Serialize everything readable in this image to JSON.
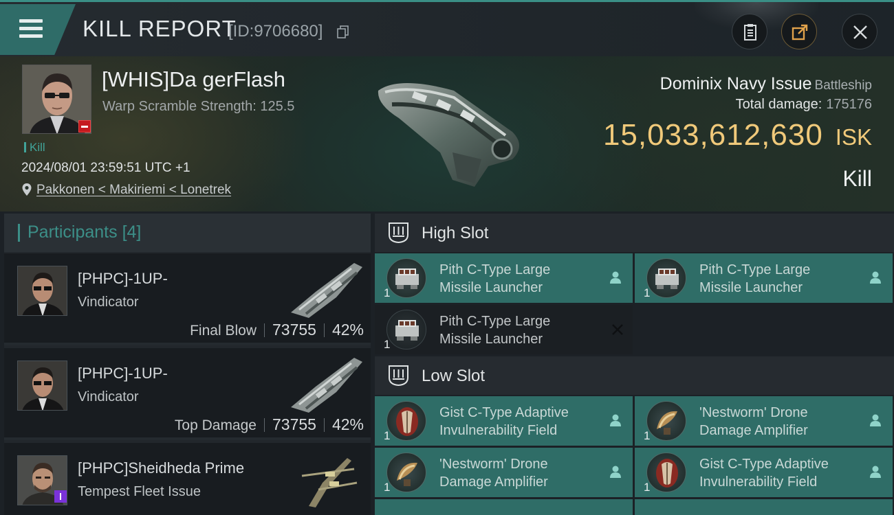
{
  "header": {
    "title": "KILL REPORT",
    "id_text": "[ID:9706680]",
    "icons": [
      "menu-icon",
      "copy-icon",
      "clipboard-icon",
      "share-icon",
      "close-icon"
    ]
  },
  "victim": {
    "name": "[WHIS]Da gerFlash",
    "warp_scramble": "Warp Scramble Strength: 125.5",
    "kill_tag": "Kill",
    "datetime": "2024/08/01 23:59:51 UTC +1",
    "location": "Pakkonen < Makiriemi < Lonetrek",
    "ship_name": "Dominix Navy Issue",
    "ship_class": "Battleship",
    "total_damage_label": "Total damage:",
    "total_damage_value": "175176",
    "isk_value": "15,033,612,630",
    "isk_unit": "ISK",
    "result": "Kill"
  },
  "participants": {
    "header": "Participants",
    "count": "[4]",
    "items": [
      {
        "name": "[PHPC]-1UP-",
        "ship": "Vindicator",
        "role": "Final Blow",
        "damage": "73755",
        "percent": "42%"
      },
      {
        "name": "[PHPC]-1UP-",
        "ship": "Vindicator",
        "role": "Top Damage",
        "damage": "73755",
        "percent": "42%"
      },
      {
        "name": "[PHPC]Sheidheda Prime",
        "ship": "Tempest Fleet Issue"
      }
    ]
  },
  "high_slot": {
    "title": "High Slot",
    "modules": [
      {
        "qty": "1",
        "line1": "Pith C-Type Large",
        "line2": "Missile Launcher",
        "status": "fitted"
      },
      {
        "qty": "1",
        "line1": "Pith C-Type Large",
        "line2": "Missile Launcher",
        "status": "fitted"
      },
      {
        "qty": "1",
        "line1": "Pith C-Type Large",
        "line2": "Missile Launcher",
        "status": "destroyed"
      }
    ]
  },
  "low_slot": {
    "title": "Low Slot",
    "modules": [
      {
        "qty": "1",
        "line1": "Gist C-Type Adaptive",
        "line2": "Invulnerability Field",
        "status": "fitted"
      },
      {
        "qty": "1",
        "line1": "'Nestworm' Drone",
        "line2": "Damage Amplifier",
        "status": "fitted"
      },
      {
        "qty": "1",
        "line1": "'Nestworm' Drone",
        "line2": "Damage Amplifier",
        "status": "fitted"
      },
      {
        "qty": "1",
        "line1": "Gist C-Type Adaptive",
        "line2": "Invulnerability Field",
        "status": "fitted"
      }
    ]
  },
  "colors": {
    "accent_teal": "#3c8f88",
    "fitted_module_bg": "#2f6d67",
    "isk_gold": "#f0c97a",
    "victim_badge_red": "#c51a1f",
    "participant_badge_purple": "#7a32d9"
  }
}
